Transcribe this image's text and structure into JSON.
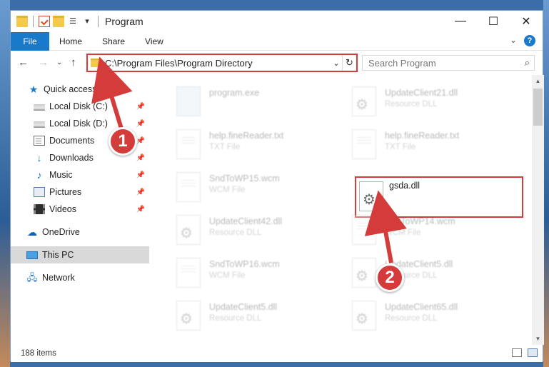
{
  "window": {
    "title": "Program",
    "controls": {
      "minimize": "—",
      "maximize": "☐",
      "close": "✕"
    }
  },
  "ribbon": {
    "file": "File",
    "tabs": [
      "Home",
      "Share",
      "View"
    ],
    "expand_icon": "chevron-down",
    "help": "?"
  },
  "address": {
    "path": "C:\\Program Files\\Program Directory",
    "search_placeholder": "Search Program"
  },
  "nav": {
    "items": [
      {
        "label": "Quick access",
        "icon": "star-icon",
        "pinned": false
      },
      {
        "label": "Local Disk (C:)",
        "icon": "drive-icon",
        "pinned": true
      },
      {
        "label": "Local Disk (D:)",
        "icon": "drive-icon",
        "pinned": true
      },
      {
        "label": "Documents",
        "icon": "documents-icon",
        "pinned": true
      },
      {
        "label": "Downloads",
        "icon": "download-icon",
        "pinned": true
      },
      {
        "label": "Music",
        "icon": "music-icon",
        "pinned": true
      },
      {
        "label": "Pictures",
        "icon": "pictures-icon",
        "pinned": true
      },
      {
        "label": "Videos",
        "icon": "videos-icon",
        "pinned": true
      },
      {
        "label": "OneDrive",
        "icon": "cloud-icon",
        "pinned": false
      },
      {
        "label": "This PC",
        "icon": "pc-icon",
        "pinned": false,
        "selected": true
      },
      {
        "label": "Network",
        "icon": "network-icon",
        "pinned": false
      }
    ]
  },
  "files": [
    {
      "name": "program.exe",
      "type": "",
      "kind": "exe"
    },
    {
      "name": "UpdateClient21.dll",
      "type": "Resource DLL",
      "kind": "dll"
    },
    {
      "name": "help.fineReader.txt",
      "type": "TXT File",
      "kind": "txt"
    },
    {
      "name": "help.fineReader.txt",
      "type": "TXT File",
      "kind": "txt"
    },
    {
      "name": "SndToWP15.wcm",
      "type": "WCM File",
      "kind": "txt"
    },
    {
      "name": "gsda.dll",
      "type": "",
      "kind": "dll",
      "highlighted": true
    },
    {
      "name": "UpdateClient42.dll",
      "type": "Resource DLL",
      "kind": "dll"
    },
    {
      "name": "SndToWP14.wcm",
      "type": "WCM File",
      "kind": "txt"
    },
    {
      "name": "SndToWP16.wcm",
      "type": "WCM File",
      "kind": "txt"
    },
    {
      "name": "UpdateClient5.dll",
      "type": "Resource DLL",
      "kind": "dll"
    },
    {
      "name": "UpdateClient5.dll",
      "type": "Resource DLL",
      "kind": "dll"
    },
    {
      "name": "UpdateClient65.dll",
      "type": "Resource DLL",
      "kind": "dll"
    }
  ],
  "status": {
    "item_count": "188 items"
  },
  "annotations": [
    {
      "number": "1",
      "color": "#d43c3c"
    },
    {
      "number": "2",
      "color": "#d43c3c"
    }
  ],
  "colors": {
    "accent": "#1979ca",
    "highlight": "#d43c3c"
  }
}
